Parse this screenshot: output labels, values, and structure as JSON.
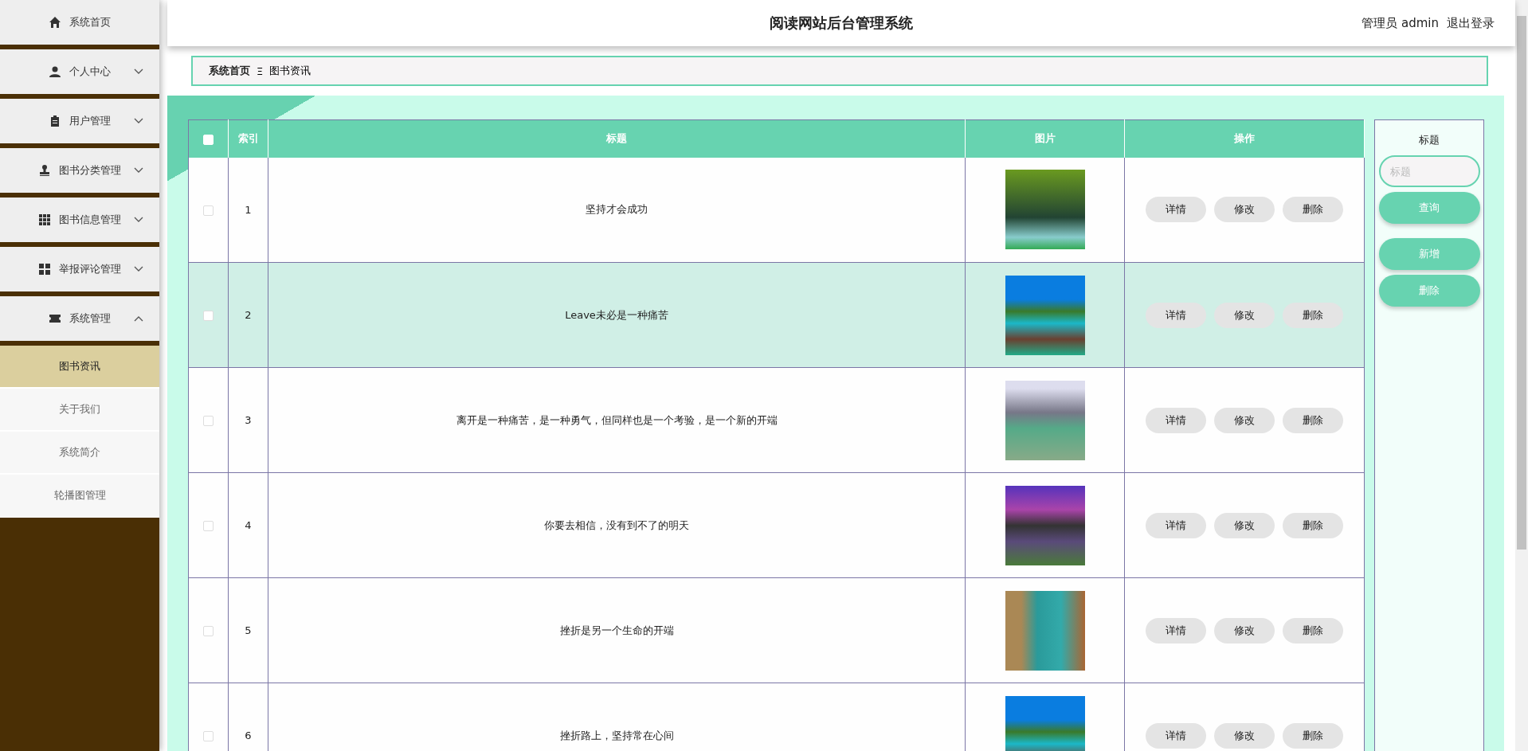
{
  "sidebar": {
    "items": [
      {
        "label": "系统首页"
      },
      {
        "label": "个人中心",
        "expanded": false
      },
      {
        "label": "用户管理",
        "expanded": false
      },
      {
        "label": "图书分类管理",
        "expanded": false
      },
      {
        "label": "图书信息管理",
        "expanded": false
      },
      {
        "label": "举报评论管理",
        "expanded": false
      },
      {
        "label": "系统管理",
        "expanded": true,
        "children": [
          {
            "label": "图书资讯",
            "selected": true
          },
          {
            "label": "关于我们",
            "selected": false
          },
          {
            "label": "系统简介",
            "selected": false
          },
          {
            "label": "轮播图管理",
            "selected": false
          }
        ]
      }
    ]
  },
  "header": {
    "title": "阅读网站后台管理系统",
    "user": "管理员 admin",
    "logout": "退出登录"
  },
  "breadcrumb": {
    "home": "系统首页",
    "separator": "Ξ",
    "current": "图书资讯"
  },
  "table": {
    "select_all_checked": false,
    "columns": [
      "索引",
      "标题",
      "图片",
      "操作"
    ],
    "rows": [
      {
        "index": "1",
        "title": "坚持才会成功",
        "checked": false,
        "selected": false,
        "actions": [
          "详情",
          "修改",
          "删除"
        ]
      },
      {
        "index": "2",
        "title": "Leave未必是一种痛苦",
        "checked": false,
        "selected": true,
        "actions": [
          "详情",
          "修改",
          "删除"
        ]
      },
      {
        "index": "3",
        "title": "离开是一种痛苦，是一种勇气，但同样也是一个考验，是一个新的开端",
        "checked": false,
        "selected": false,
        "actions": [
          "详情",
          "修改",
          "删除"
        ]
      },
      {
        "index": "4",
        "title": "你要去相信，没有到不了的明天",
        "checked": false,
        "selected": false,
        "actions": [
          "详情",
          "修改",
          "删除"
        ]
      },
      {
        "index": "5",
        "title": "挫折是另一个生命的开端",
        "checked": false,
        "selected": false,
        "actions": [
          "详情",
          "修改",
          "删除"
        ]
      },
      {
        "index": "6",
        "title": "挫折路上，坚持常在心间",
        "checked": false,
        "selected": false,
        "actions": [
          "详情",
          "修改",
          "删除"
        ]
      }
    ]
  },
  "search_panel": {
    "label": "标题",
    "placeholder": "标题",
    "search_button": "查询",
    "add_button": "新增",
    "delete_button": "删除"
  }
}
